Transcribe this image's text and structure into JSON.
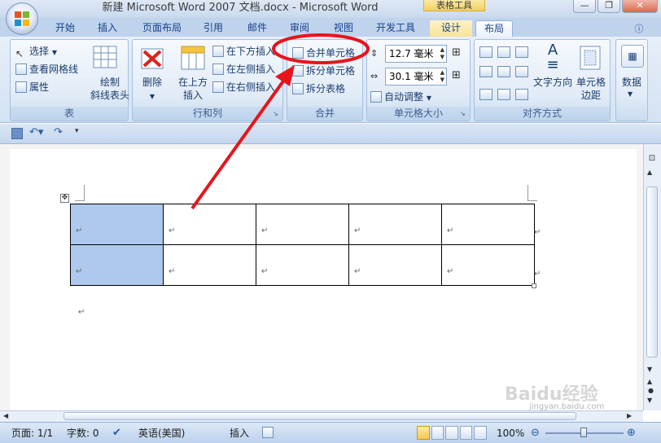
{
  "window": {
    "title": "新建 Microsoft Word 2007 文档.docx - Microsoft Word",
    "context_tab_group": "表格工具"
  },
  "tabs": [
    "开始",
    "插入",
    "页面布局",
    "引用",
    "邮件",
    "审阅",
    "视图",
    "开发工具",
    "设计",
    "布局"
  ],
  "active_tab": "布局",
  "ribbon": {
    "table_group": {
      "label": "表",
      "select": "选择",
      "view_gridlines": "查看网格线",
      "properties": "属性",
      "draw_diagonal_line1": "绘制",
      "draw_diagonal_line2": "斜线表头"
    },
    "rows_cols_group": {
      "label": "行和列",
      "delete": "删除",
      "insert_above1": "在上方",
      "insert_above2": "插入",
      "insert_below": "在下方插入",
      "insert_left": "在左侧插入",
      "insert_right": "在右侧插入"
    },
    "merge_group": {
      "label": "合并",
      "merge_cells": "合并单元格",
      "split_cells": "拆分单元格",
      "split_table": "拆分表格"
    },
    "cell_size_group": {
      "label": "单元格大小",
      "height": "12.7 毫米",
      "width": "30.1 毫米",
      "autofit": "自动调整"
    },
    "alignment_group": {
      "label": "对齐方式",
      "text_direction": "文字方向",
      "cell_margins1": "单元格",
      "cell_margins2": "边距"
    },
    "data_group": {
      "label": "数据"
    }
  },
  "document": {
    "rows": 2,
    "cols": 5,
    "selected_cells": [
      [
        0,
        0
      ],
      [
        1,
        0
      ]
    ],
    "paragraph_mark": "↵"
  },
  "statusbar": {
    "page": "页面: 1/1",
    "words": "字数: 0",
    "language": "英语(美国)",
    "mode": "插入",
    "zoom": "100%"
  },
  "watermark": "Baidu经验 jingyan.baidu.com",
  "colors": {
    "annotation_red": "#e8141c",
    "selection": "#afc9ee",
    "ribbon_text": "#15428b"
  }
}
